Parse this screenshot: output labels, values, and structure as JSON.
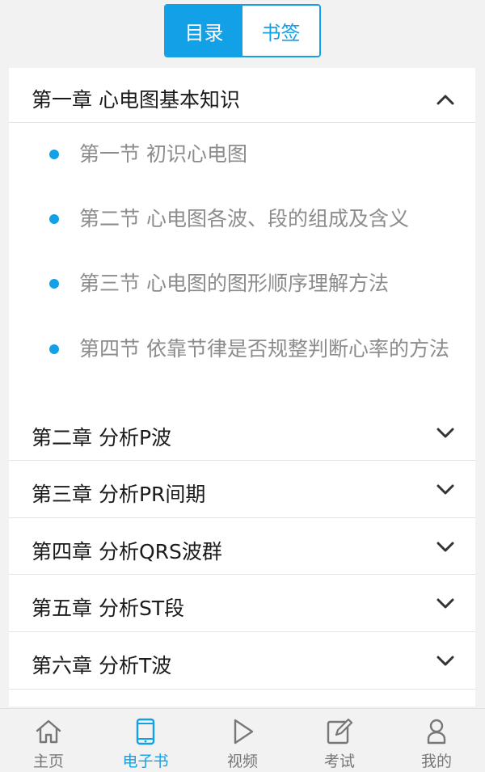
{
  "tabs_top": [
    {
      "label": "目录",
      "active": true
    },
    {
      "label": "书签",
      "active": false
    }
  ],
  "chapters": [
    {
      "title": "第一章 心电图基本知识",
      "expanded": true,
      "sections": [
        "第一节 初识心电图",
        "第二节 心电图各波、段的组成及含义",
        "第三节 心电图的图形顺序理解方法",
        "第四节 依靠节律是否规整判断心率的方法"
      ]
    },
    {
      "title": "第二章 分析P波",
      "expanded": false
    },
    {
      "title": "第三章 分析PR间期",
      "expanded": false
    },
    {
      "title": "第四章 分析QRS波群",
      "expanded": false
    },
    {
      "title": "第五章 分析ST段",
      "expanded": false
    },
    {
      "title": "第六章 分析T波",
      "expanded": false
    }
  ],
  "bottom_nav": [
    {
      "label": "主页",
      "icon": "home-icon",
      "active": false
    },
    {
      "label": "电子书",
      "icon": "tablet-icon",
      "active": true
    },
    {
      "label": "视频",
      "icon": "play-icon",
      "active": false
    },
    {
      "label": "考试",
      "icon": "edit-icon",
      "active": false
    },
    {
      "label": "我的",
      "icon": "user-icon",
      "active": false
    }
  ],
  "colors": {
    "accent": "#12a1e6",
    "muted": "#8c8c8c"
  }
}
